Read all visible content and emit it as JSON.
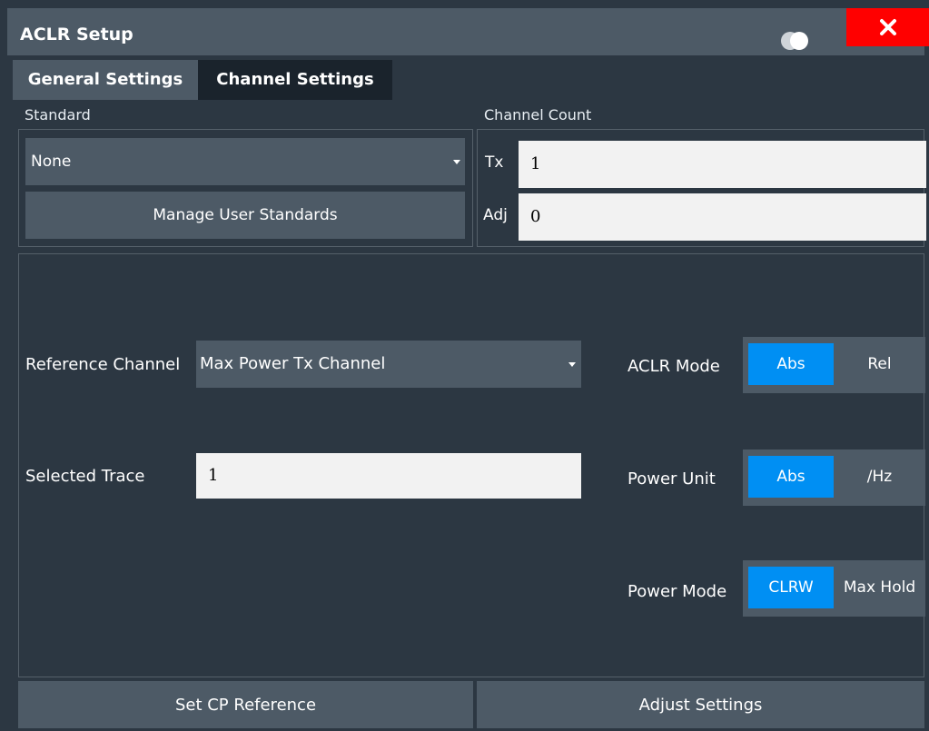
{
  "window": {
    "title": "ACLR Setup",
    "close_symbol": "✕",
    "icons": [
      "toggle-icon",
      "close-icon",
      "dropdown-caret-icon"
    ]
  },
  "tabs": [
    {
      "label": "General Settings",
      "active": true
    },
    {
      "label": "Channel Settings",
      "active": false
    }
  ],
  "standard": {
    "label": "Standard",
    "selected": "None",
    "manage_button": "Manage User Standards"
  },
  "channel_count": {
    "label": "Channel Count",
    "tx_label": "Tx",
    "tx_value": "1",
    "adj_label": "Adj",
    "adj_value": "0"
  },
  "reference_channel": {
    "label": "Reference Channel",
    "selected": "Max Power Tx Channel"
  },
  "selected_trace": {
    "label": "Selected Trace",
    "value": "1"
  },
  "aclr_mode": {
    "label": "ACLR Mode",
    "options": [
      "Abs",
      "Rel"
    ],
    "selected": "Abs"
  },
  "power_unit": {
    "label": "Power Unit",
    "options": [
      "Abs",
      "/Hz"
    ],
    "selected": "Abs"
  },
  "power_mode": {
    "label": "Power Mode",
    "options": [
      "CLRW",
      "Max Hold"
    ],
    "selected": "CLRW"
  },
  "buttons": {
    "set_cp_reference": "Set CP Reference",
    "adjust_settings": "Adjust Settings"
  },
  "colors": {
    "background": "#2c3742",
    "panel": "#4d5a66",
    "accent": "#008ff3",
    "close": "#ff0000",
    "input_bg": "#f2f2f2"
  }
}
